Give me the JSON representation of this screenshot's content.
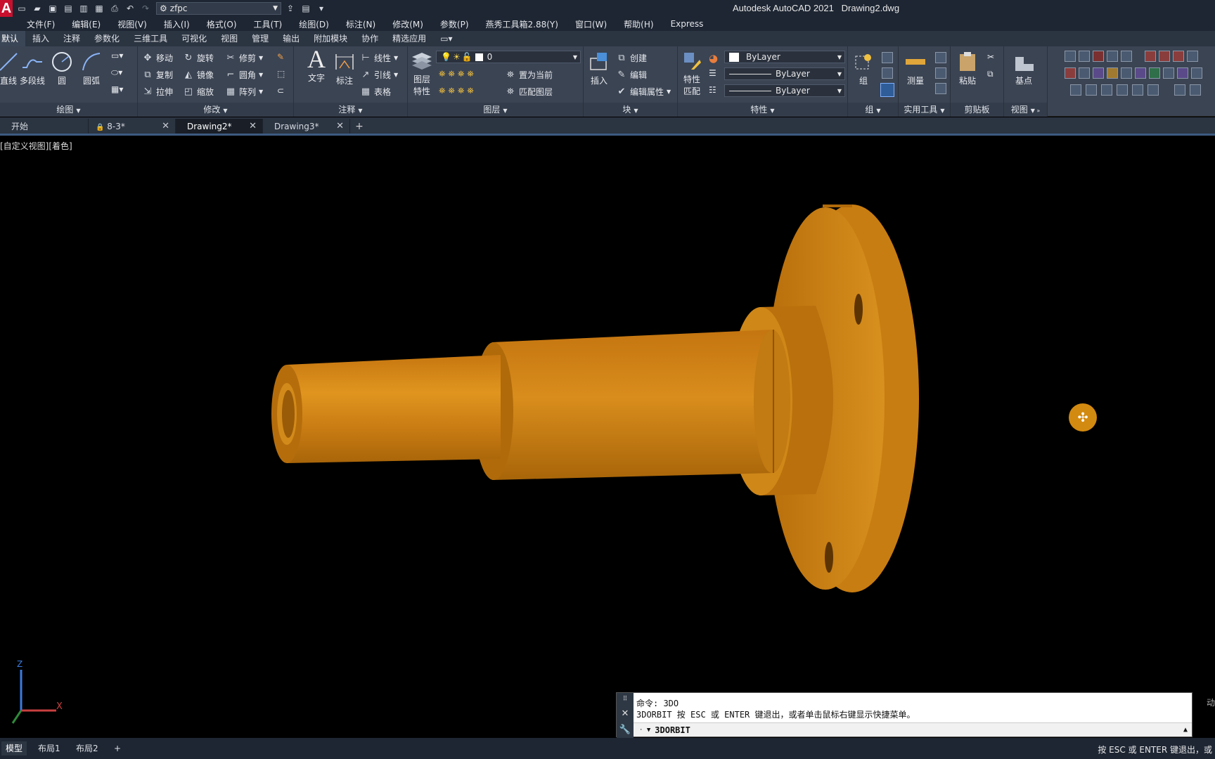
{
  "app": {
    "logo": "A",
    "title": "Autodesk AutoCAD 2021",
    "document": "Drawing2.dwg",
    "workspace": "zfpc"
  },
  "quick_access": [
    "new-icon",
    "open-icon",
    "save-icon",
    "save-as-icon",
    "publish-icon",
    "export-icon",
    "print-icon",
    "undo-icon",
    "redo-icon"
  ],
  "menu": [
    "文件(F)",
    "编辑(E)",
    "视图(V)",
    "插入(I)",
    "格式(O)",
    "工具(T)",
    "绘图(D)",
    "标注(N)",
    "修改(M)",
    "参数(P)",
    "燕秀工具箱2.88(Y)",
    "窗口(W)",
    "帮助(H)",
    "Express"
  ],
  "ribbon_tabs": [
    "默认",
    "插入",
    "注释",
    "参数化",
    "三维工具",
    "可视化",
    "视图",
    "管理",
    "输出",
    "附加模块",
    "协作",
    "精选应用"
  ],
  "draw_panel": {
    "title": "绘图",
    "line": "直线",
    "polyline": "多段线",
    "circle": "圆",
    "arc": "圆弧"
  },
  "modify_panel": {
    "title": "修改",
    "move": "移动",
    "rotate": "旋转",
    "trim": "修剪",
    "copy": "复制",
    "mirror": "镜像",
    "fillet": "圆角",
    "stretch": "拉伸",
    "scale": "缩放",
    "array": "阵列"
  },
  "annotation_panel": {
    "title": "注释",
    "text": "文字",
    "dimension": "标注",
    "linear": "线性",
    "leader": "引线",
    "table": "表格"
  },
  "layers_panel": {
    "title": "图层",
    "properties_line1": "图层",
    "properties_line2": "特性",
    "current_layer": "0",
    "make_current": "置为当前",
    "match_layer": "匹配图层"
  },
  "block_panel": {
    "title": "块",
    "insert": "插入",
    "create": "创建",
    "edit": "编辑",
    "edit_attributes": "编辑属性"
  },
  "properties_panel": {
    "title": "特性",
    "match_line1": "特性",
    "match_line2": "匹配",
    "color": "ByLayer",
    "lineweight": "ByLayer",
    "linetype": "ByLayer"
  },
  "groups_panel": {
    "title": "组",
    "group": "组"
  },
  "utilities_panel": {
    "title": "实用工具",
    "measure": "测量"
  },
  "clipboard_panel": {
    "title": "剪贴板",
    "paste": "粘贴"
  },
  "view_panel": {
    "title": "视图",
    "base": "基点"
  },
  "file_tabs": [
    {
      "label": "开始",
      "closable": false
    },
    {
      "label": "8-3*",
      "closable": true,
      "locked": true
    },
    {
      "label": "Drawing2*",
      "closable": true,
      "active": true
    },
    {
      "label": "Drawing3*",
      "closable": true
    }
  ],
  "viewport": {
    "label": "[自定义视图][着色]",
    "model_color": "#c7780f",
    "ucs_labels": {
      "z": "Z",
      "x": "X"
    }
  },
  "command_line": {
    "history": [
      "命令: 3DO",
      "3DORBIT 按 ESC 或 ENTER 键退出，或者单击鼠标右键显示快捷菜单。"
    ],
    "current": "3DORBIT"
  },
  "layout_tabs": [
    "模型",
    "布局1",
    "布局2"
  ],
  "status_text": "按 ESC 或 ENTER 键退出，或"
}
